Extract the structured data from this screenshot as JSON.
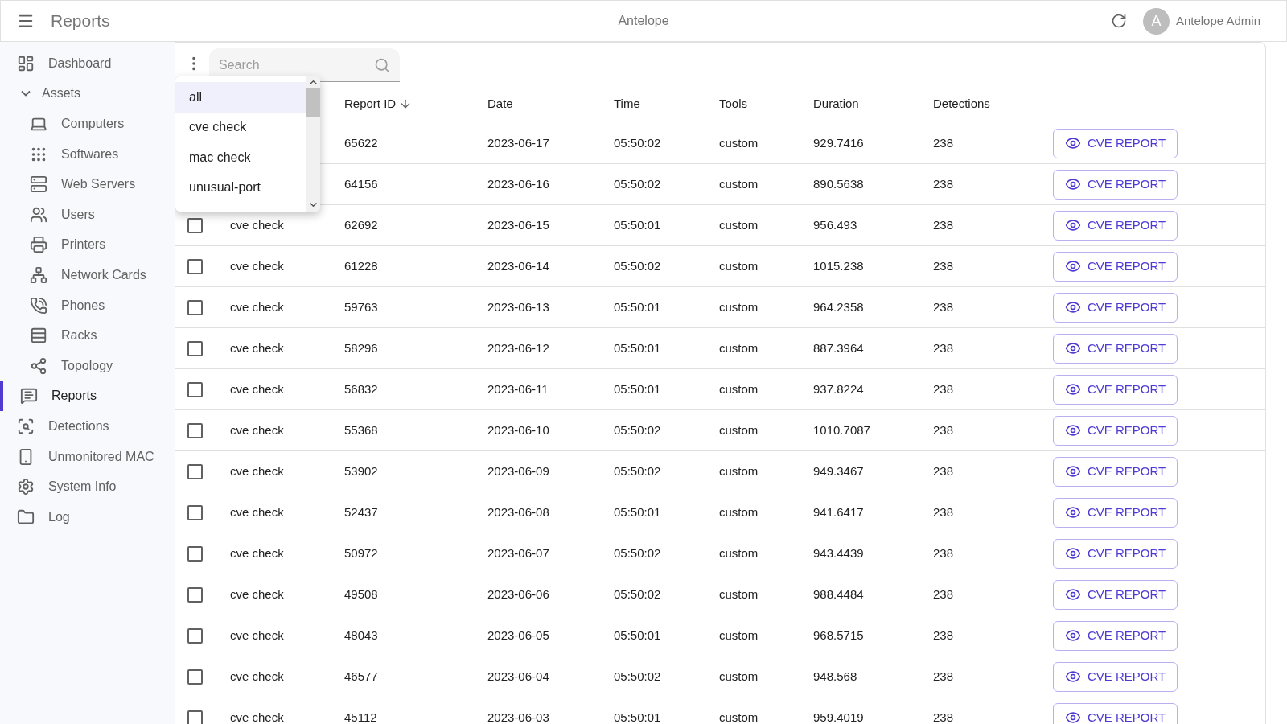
{
  "app_bar": {
    "title": "Reports",
    "center_title": "Antelope",
    "user": {
      "initial": "A",
      "name": "Antelope Admin"
    }
  },
  "sidebar": {
    "items": [
      {
        "label": "Dashboard",
        "selected": false
      },
      {
        "label": "Assets",
        "selected": false,
        "expanded": true,
        "children": [
          {
            "label": "Computers",
            "selected": false
          },
          {
            "label": "Softwares",
            "selected": false
          },
          {
            "label": "Web Servers",
            "selected": false
          },
          {
            "label": "Users",
            "selected": false
          },
          {
            "label": "Printers",
            "selected": false
          },
          {
            "label": "Network Cards",
            "selected": false
          },
          {
            "label": "Phones",
            "selected": false
          },
          {
            "label": "Racks",
            "selected": false
          },
          {
            "label": "Topology",
            "selected": false
          }
        ]
      },
      {
        "label": "Reports",
        "selected": true
      },
      {
        "label": "Detections",
        "selected": false
      },
      {
        "label": "Unmonitored MAC",
        "selected": false
      },
      {
        "label": "System Info",
        "selected": false
      },
      {
        "label": "Log",
        "selected": false
      }
    ]
  },
  "toolbar": {
    "search": {
      "placeholder": "Search"
    }
  },
  "filter_menu": {
    "options": [
      {
        "label": "all",
        "selected": true
      },
      {
        "label": "cve check",
        "selected": false
      },
      {
        "label": "mac check",
        "selected": false
      },
      {
        "label": "unusual-port",
        "selected": false
      }
    ]
  },
  "table": {
    "columns": [
      {
        "label": "Report ID",
        "sorted": true
      },
      {
        "label": "Date",
        "sorted": false
      },
      {
        "label": "Time",
        "sorted": false
      },
      {
        "label": "Tools",
        "sorted": false
      },
      {
        "label": "Duration",
        "sorted": false
      },
      {
        "label": "Detections",
        "sorted": false
      }
    ],
    "rows": [
      {
        "report_id": "65622",
        "date": "2023-06-17",
        "time": "05:50:02",
        "tools": "custom",
        "duration": "929.7416",
        "detections": "238",
        "action": "CVE REPORT"
      },
      {
        "report_id": "64156",
        "date": "2023-06-16",
        "time": "05:50:02",
        "tools": "custom",
        "duration": "890.5638",
        "detections": "238",
        "action": "CVE REPORT"
      },
      {
        "checked": false,
        "type": "cve check",
        "report_id": "62692",
        "date": "2023-06-15",
        "time": "05:50:01",
        "tools": "custom",
        "duration": "956.493",
        "detections": "238",
        "action": "CVE REPORT"
      },
      {
        "checked": false,
        "type": "cve check",
        "report_id": "61228",
        "date": "2023-06-14",
        "time": "05:50:02",
        "tools": "custom",
        "duration": "1015.238",
        "detections": "238",
        "action": "CVE REPORT"
      },
      {
        "checked": false,
        "type": "cve check",
        "report_id": "59763",
        "date": "2023-06-13",
        "time": "05:50:01",
        "tools": "custom",
        "duration": "964.2358",
        "detections": "238",
        "action": "CVE REPORT"
      },
      {
        "checked": false,
        "type": "cve check",
        "report_id": "58296",
        "date": "2023-06-12",
        "time": "05:50:01",
        "tools": "custom",
        "duration": "887.3964",
        "detections": "238",
        "action": "CVE REPORT"
      },
      {
        "checked": false,
        "type": "cve check",
        "report_id": "56832",
        "date": "2023-06-11",
        "time": "05:50:01",
        "tools": "custom",
        "duration": "937.8224",
        "detections": "238",
        "action": "CVE REPORT"
      },
      {
        "checked": false,
        "type": "cve check",
        "report_id": "55368",
        "date": "2023-06-10",
        "time": "05:50:02",
        "tools": "custom",
        "duration": "1010.7087",
        "detections": "238",
        "action": "CVE REPORT"
      },
      {
        "checked": false,
        "type": "cve check",
        "report_id": "53902",
        "date": "2023-06-09",
        "time": "05:50:02",
        "tools": "custom",
        "duration": "949.3467",
        "detections": "238",
        "action": "CVE REPORT"
      },
      {
        "checked": false,
        "type": "cve check",
        "report_id": "52437",
        "date": "2023-06-08",
        "time": "05:50:01",
        "tools": "custom",
        "duration": "941.6417",
        "detections": "238",
        "action": "CVE REPORT"
      },
      {
        "checked": false,
        "type": "cve check",
        "report_id": "50972",
        "date": "2023-06-07",
        "time": "05:50:02",
        "tools": "custom",
        "duration": "943.4439",
        "detections": "238",
        "action": "CVE REPORT"
      },
      {
        "checked": false,
        "type": "cve check",
        "report_id": "49508",
        "date": "2023-06-06",
        "time": "05:50:02",
        "tools": "custom",
        "duration": "988.4484",
        "detections": "238",
        "action": "CVE REPORT"
      },
      {
        "checked": false,
        "type": "cve check",
        "report_id": "48043",
        "date": "2023-06-05",
        "time": "05:50:01",
        "tools": "custom",
        "duration": "968.5715",
        "detections": "238",
        "action": "CVE REPORT"
      },
      {
        "checked": false,
        "type": "cve check",
        "report_id": "46577",
        "date": "2023-06-04",
        "time": "05:50:02",
        "tools": "custom",
        "duration": "948.568",
        "detections": "238",
        "action": "CVE REPORT"
      },
      {
        "checked": false,
        "type": "cve check",
        "report_id": "45112",
        "date": "2023-06-03",
        "time": "05:50:01",
        "tools": "custom",
        "duration": "959.4019",
        "detections": "238",
        "action": "CVE REPORT"
      }
    ]
  }
}
